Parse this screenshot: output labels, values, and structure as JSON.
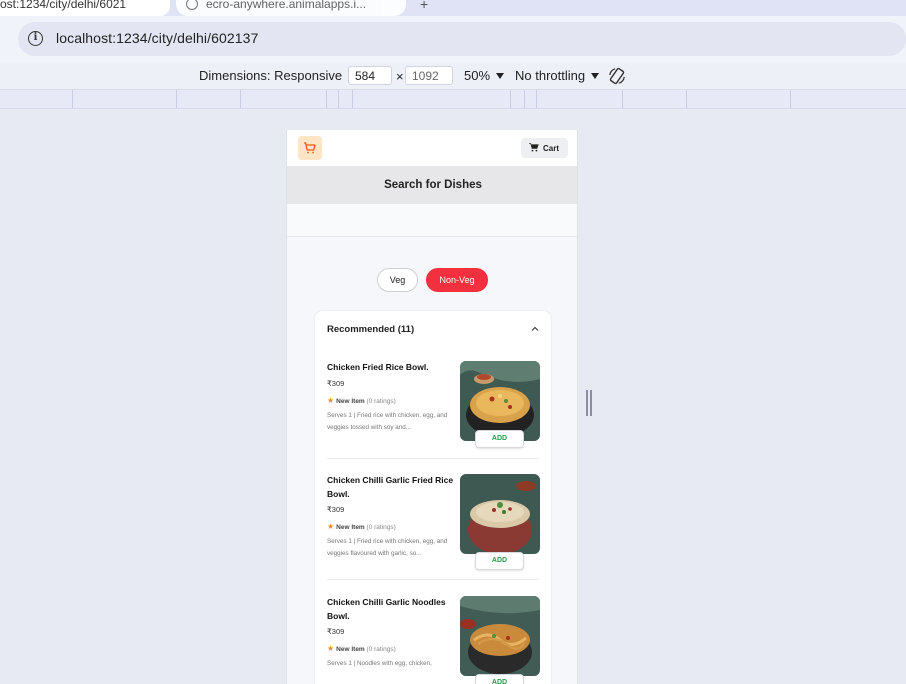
{
  "browser": {
    "active_tab_title": "ost:1234/city/delhi/6021",
    "inactive_tab_title": "ecro-anywhere.animalapps.i...",
    "new_tab_symbol": "+",
    "url": "localhost:1234/city/delhi/602137"
  },
  "devtools": {
    "dimensions_label": "Dimensions: Responsive",
    "width": "584",
    "times": "×",
    "height": "1092",
    "zoom": "50%",
    "throttling": "No throttling"
  },
  "app": {
    "cart_label": "Cart",
    "search_label": "Search for Dishes",
    "filters": [
      {
        "label": "Veg",
        "active": false
      },
      {
        "label": "Non-Veg",
        "active": true
      }
    ],
    "section": {
      "title": "Recommended (11)"
    },
    "dishes": [
      {
        "name": "Chicken Fried Rice Bowl.",
        "price": "₹309",
        "rating_tag": "New Item",
        "rating_count": "(0 ratings)",
        "description": "Serves 1 | Fried rice with chicken, egg, and veggies tossed with soy and...",
        "add_label": "ADD"
      },
      {
        "name": "Chicken Chilli Garlic Fried Rice Bowl.",
        "price": "₹309",
        "rating_tag": "New Item",
        "rating_count": "(0 ratings)",
        "description": "Serves 1 | Fried rice with chicken, egg, and veggies flavoured with garlic, so...",
        "add_label": "ADD"
      },
      {
        "name": "Chicken Chilli Garlic Noodles Bowl.",
        "price": "₹309",
        "rating_tag": "New Item",
        "rating_count": "(0 ratings)",
        "description": "Serves 1 | Noodles with egg, chicken,",
        "add_label": "ADD"
      }
    ]
  },
  "colors": {
    "accent_red": "#f5303e",
    "add_green": "#1f9d44",
    "star_orange": "#f28b1d",
    "logo_bg": "#fde5c5"
  },
  "icons": [
    "info-icon",
    "cart-icon",
    "logo-cart-icon",
    "chevron-up-icon",
    "star-icon",
    "rotate-icon",
    "globe-icon"
  ]
}
